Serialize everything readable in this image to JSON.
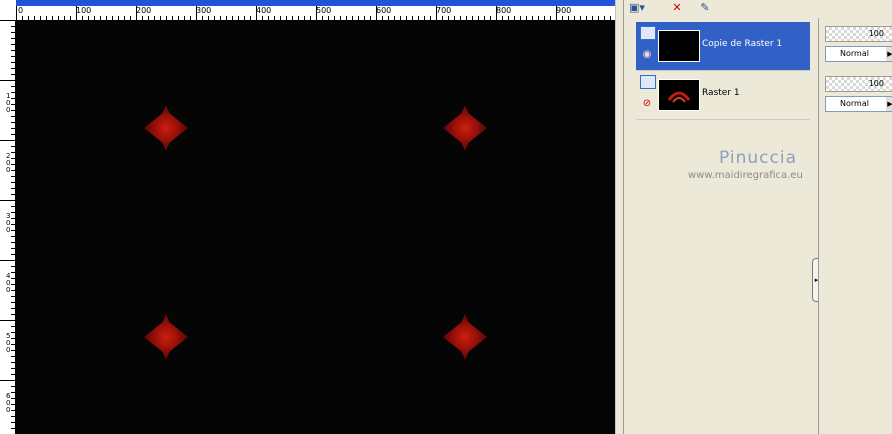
{
  "ruler": {
    "h_labels": [
      "0",
      "100",
      "200",
      "300",
      "400",
      "500",
      "600",
      "700",
      "800",
      "900"
    ],
    "v_labels": [
      "1 0 0",
      "2 0 0",
      "3 0 0",
      "4 0 0",
      "5 0 0",
      "6 0 0"
    ]
  },
  "canvas": {
    "background": "#050505",
    "accent": "#d8210d"
  },
  "layers": {
    "toolbar": {
      "new_layer_icon": "new-layer-icon",
      "delete_layer_icon": "delete-layer-icon",
      "edit_icon": "edit-icon"
    },
    "items": [
      {
        "name": "Copie de Raster 1",
        "visibility_icon": "eye-icon",
        "selected": true
      },
      {
        "name": "Raster 1",
        "visibility_icon": "eye-hidden-icon",
        "selected": false
      }
    ],
    "watermark_name": "Pinuccia",
    "watermark_url": "www.maidiregrafica.eu"
  },
  "properties": [
    {
      "opacity": "100",
      "blend_mode": "Normal"
    },
    {
      "opacity": "100",
      "blend_mode": "Normal"
    }
  ]
}
